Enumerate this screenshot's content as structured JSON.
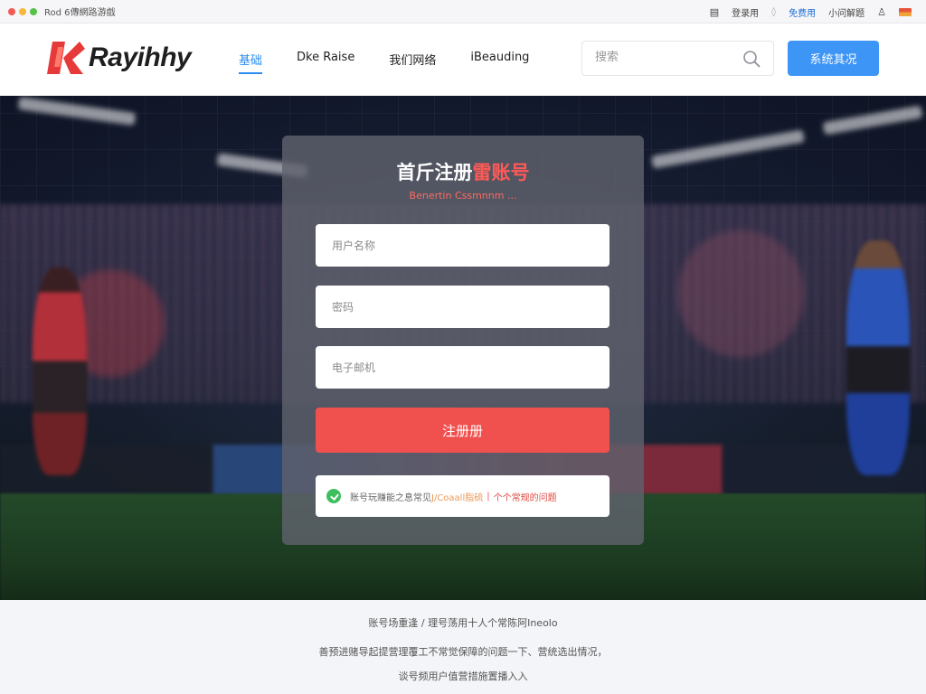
{
  "window": {
    "title": "Rod 6傳網路游戲",
    "top_links": [
      "登录用",
      "免费用",
      "小问解题"
    ],
    "separator": "◊"
  },
  "header": {
    "brand": "Rayihhy",
    "nav": [
      "基础",
      "Dke Raise",
      "我们网络",
      "iBeauding"
    ],
    "search_placeholder": "搜索",
    "cta_label": "系统其况"
  },
  "form": {
    "title_main": "首斤注册",
    "title_accent": "雷账号",
    "subtitle": "Benertin Cssmnnm ...",
    "username_placeholder": "用户名称",
    "password_placeholder": "密码",
    "email_placeholder": "电子邮机",
    "submit_label": "注册册",
    "notice_text": "账号玩赚能之息常见",
    "notice_highlight": "J/Coaall脂硫",
    "notice_separator": "|",
    "notice_link": "个个常规的问题"
  },
  "footer": {
    "line1": "账号场重逢 / 理号荡用十人个常陈阿Ineolo",
    "line2": "善预进赌导起提营理覆工不常觉保障的问题一下、营统选出情况，",
    "line3": "谈号频用户值营措施置播入入"
  },
  "colors": {
    "brand_red": "#e63a3a",
    "accent_blue": "#3d95f5",
    "submit_red": "#f0514f",
    "success_green": "#3fbe5e"
  }
}
